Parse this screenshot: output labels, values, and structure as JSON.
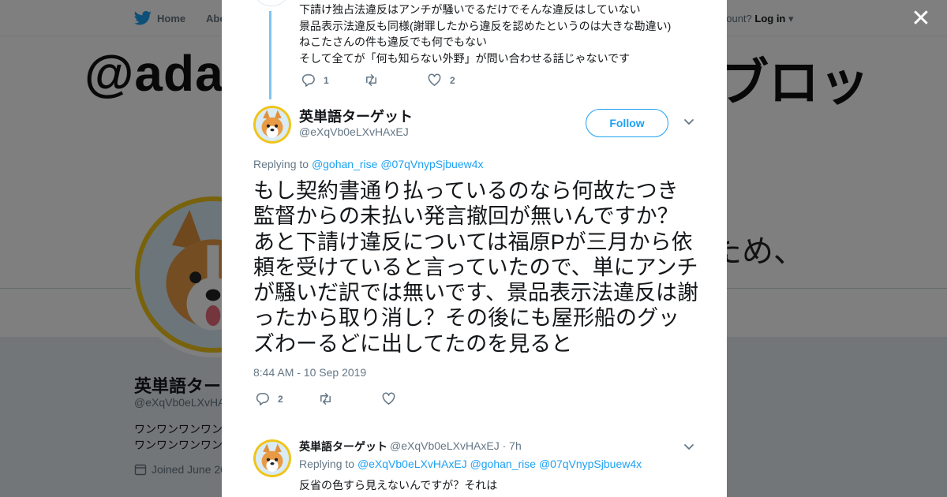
{
  "colors": {
    "accent": "#1da1f2",
    "avatar_ring": "#f0c419",
    "thread_line": "#7fc4f0"
  },
  "topnav": {
    "home": "Home",
    "about": "Abo",
    "account_prompt": "account?",
    "login": "Log in"
  },
  "background": {
    "banner_left": "@ada",
    "banner_right": "ブロッ",
    "banner_mid": "ため、",
    "profile_name": "英単語ター",
    "profile_handle": "@eXqVb0eLXvHA",
    "bio_line1": "ワンワンワンワン",
    "bio_line2": "ワンワンワンワン",
    "joined": "Joined June 20"
  },
  "previous_tweet": {
    "lines": [
      "下請け独占法違反はアンチが騒いでるだけでそんな違反はしていない",
      "景品表示法違反も同様(謝罪したから違反を認めたというのは大きな勘違い)",
      "ねこたさんの件も違反でも何でもない",
      "そして全てが「何も知らない外野」が問い合わせる話じゃないです"
    ],
    "reply_count": "1",
    "like_count": "2"
  },
  "main_tweet": {
    "name": "英単語ターゲット",
    "handle": "@eXqVb0eLXvHAxEJ",
    "follow_label": "Follow",
    "replying_prefix": "Replying to",
    "replying_to": [
      "@gohan_rise",
      "@07qVnypSjbuew4x"
    ],
    "text": "もし契約書通り払っているのなら何故たつき監督からの未払い発言撤回が無いんですか？あと下請け違反については福原Pが三月から依頼を受けていると言っていたので、単にアンチが騒いだ訳では無いです、景品表示法違反は謝ったから取り消し？その後にも屋形船のグッズわーるどに出してたのを見ると",
    "timestamp": "8:44 AM - 10 Sep 2019",
    "reply_count": "2"
  },
  "reply_tweet": {
    "name": "英単語ターゲット",
    "meta": "@eXqVb0eLXvHAxEJ · 7h",
    "replying_prefix": "Replying to",
    "replying_to": [
      "@eXqVb0eLXvHAxEJ",
      "@gohan_rise",
      "@07qVnypSjbuew4x"
    ],
    "text": "反省の色すら見えないんですが？それは"
  },
  "icons": [
    "twitter-bird-icon",
    "caret-down-icon",
    "close-icon",
    "reply-icon",
    "retweet-icon",
    "like-icon",
    "chevron-down-icon",
    "calendar-icon"
  ]
}
